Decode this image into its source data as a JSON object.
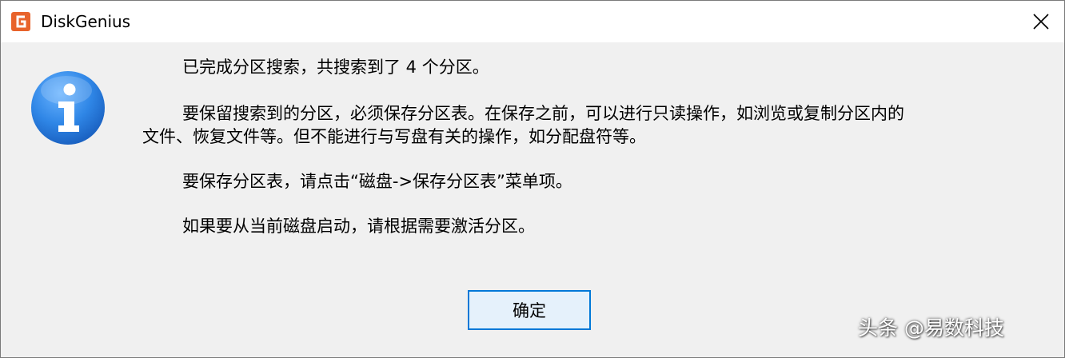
{
  "window": {
    "title": "DiskGenius",
    "close_glyph": "✕"
  },
  "icons": {
    "app": "diskgenius-logo-icon",
    "message": "info-icon",
    "close": "close-icon"
  },
  "colors": {
    "app_icon": "#e8632b",
    "info_icon": "#2f86e6",
    "button_border": "#0078d7",
    "button_fill": "#e5f1fb",
    "title_bar": "#ffffff",
    "dialog_bg": "#f0f0f0"
  },
  "message": {
    "line1": "已完成分区搜索，共搜索到了 4 个分区。",
    "line2": "要保留搜索到的分区，必须保存分区表。在保存之前，可以进行只读操作，如浏览或复制分区内的",
    "line3": "文件、恢复文件等。但不能进行与写盘有关的操作，如分配盘符等。",
    "line4": "要保存分区表，请点击“磁盘->保存分区表”菜单项。",
    "line5": "如果要从当前磁盘启动，请根据需要激活分区。"
  },
  "buttons": {
    "ok_label": "确定"
  },
  "watermark": {
    "text": "头条 @易数科技"
  }
}
